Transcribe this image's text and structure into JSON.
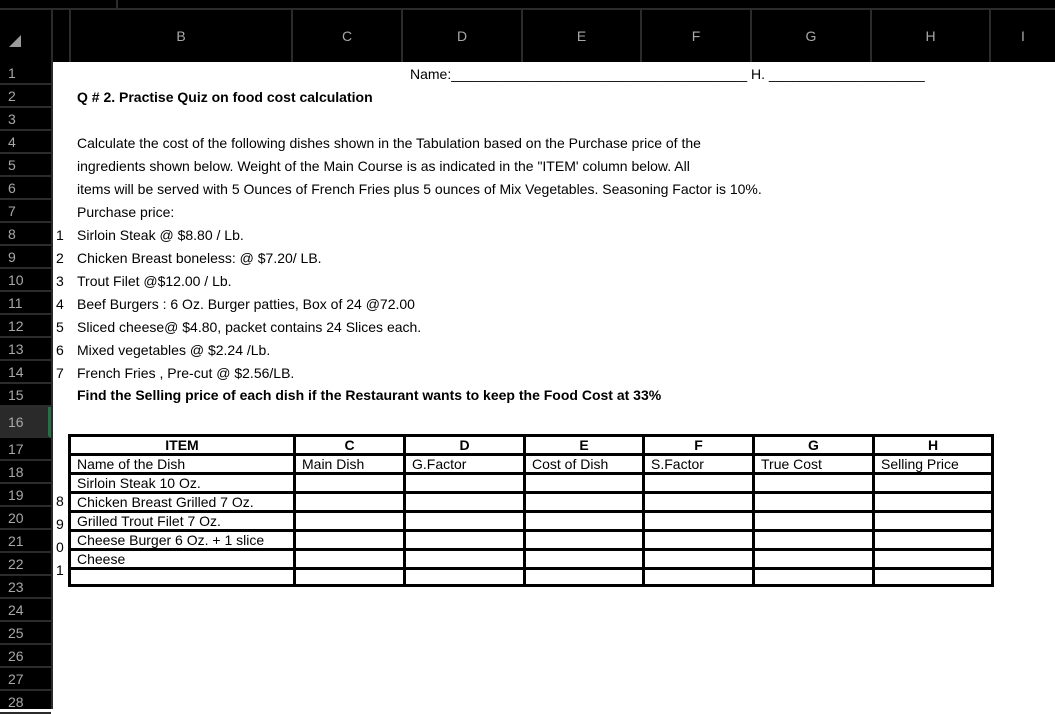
{
  "app": "Spreadsheet",
  "columns": [
    "B",
    "C",
    "D",
    "E",
    "F",
    "G",
    "H",
    "I"
  ],
  "rows": [
    "1",
    "2",
    "3",
    "4",
    "5",
    "6",
    "7",
    "8",
    "9",
    "10",
    "11",
    "12",
    "13",
    "14",
    "15",
    "16",
    "17",
    "18",
    "19",
    "20",
    "21",
    "22",
    "23",
    "24",
    "25",
    "26",
    "27",
    "28"
  ],
  "selected_row": "16",
  "colors": {
    "selection_accent": "#217346",
    "header_bg": "#000000",
    "header_text": "#a8a8a8"
  },
  "sheet": {
    "name_line": "Name:______________________________________ H. ____________________",
    "title": "Q # 2. Practise Quiz on food cost calculation",
    "instructions": [
      "Calculate the cost of the following dishes shown in the Tabulation based on the Purchase price of the",
      "ingredients shown below. Weight of the Main Course is as indicated in the \"ITEM' column below. All",
      "items will be served with 5 Ounces of French Fries plus 5 ounces of Mix Vegetables. Seasoning Factor is 10%.",
      "Purchase price:"
    ],
    "prices": [
      {
        "num": "1",
        "text": "Sirloin Steak  @  $8.80 / Lb."
      },
      {
        "num": "2",
        "text": "Chicken Breast boneless: @ $7.20/ LB."
      },
      {
        "num": "3",
        "text": "Trout Filet @$12.00 / Lb."
      },
      {
        "num": "4",
        "text": "Beef Burgers : 6 Oz. Burger patties, Box of 24 @72.00"
      },
      {
        "num": "5",
        "text": "Sliced cheese@ $4.80, packet contains 24 Slices each."
      },
      {
        "num": "6",
        "text": "Mixed vegetables @ $2.24 /Lb."
      },
      {
        "num": "7",
        "text": "French Fries , Pre-cut @ $2.56/LB."
      }
    ],
    "task": "Find the Selling price of each dish if the Restaurant wants to keep the Food Cost at 33%",
    "table": {
      "letters": [
        "ITEM",
        "C",
        "D",
        "E",
        "F",
        "G",
        "H"
      ],
      "headers": [
        "Name of the Dish",
        "Main Dish",
        "G.Factor",
        "Cost of Dish",
        "S.Factor",
        "True Cost",
        "Selling Price"
      ],
      "rows": [
        {
          "num": "8",
          "dish": "Sirloin Steak  10 Oz."
        },
        {
          "num": "9",
          "dish": " Chicken Breast Grilled 7 Oz."
        },
        {
          "num": "0",
          "dish": "Grilled Trout Filet 7 Oz."
        },
        {
          "num": "1",
          "dish": "Cheese Burger 6 Oz. + 1 slice"
        },
        {
          "num": "",
          "dish": "Cheese"
        },
        {
          "num": "",
          "dish": ""
        }
      ]
    }
  }
}
